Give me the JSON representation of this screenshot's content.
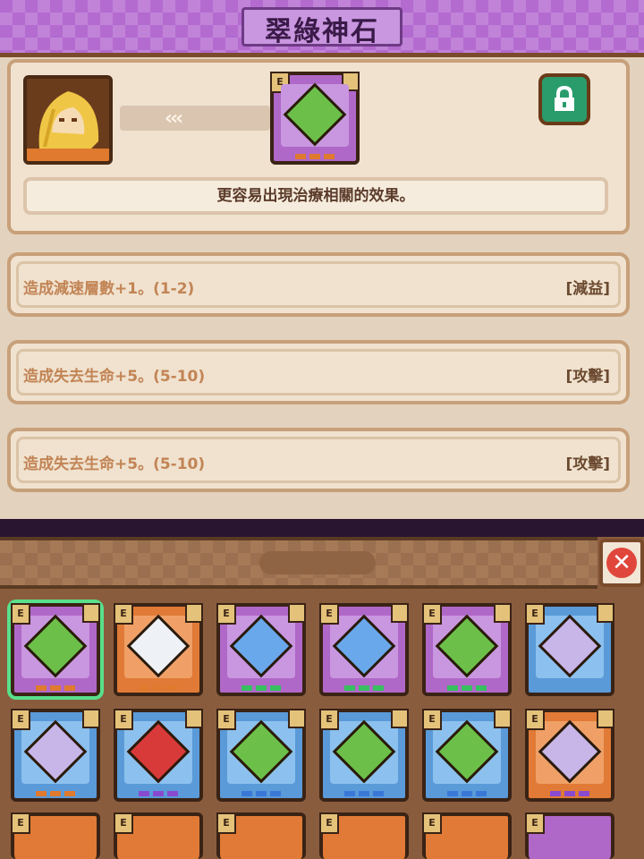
{
  "header": {
    "title": "翠綠神石"
  },
  "item": {
    "description": "更容易出現治療相關的效果。",
    "arrows": "‹‹‹"
  },
  "affixes": [
    {
      "text": "造成減速層數+1。(1-2)",
      "tag": "[減益]"
    },
    {
      "text": "造成失去生命+5。(5-10)",
      "tag": "[攻擊]"
    },
    {
      "text": "造成失去生命+5。(5-10)",
      "tag": "[攻擊]"
    }
  ],
  "inventory": {
    "badge_letter": "E",
    "close_glyph": "✕",
    "gems": [
      {
        "frame": "purple",
        "gem": "green",
        "dots": "orange",
        "selected": true
      },
      {
        "frame": "orange",
        "gem": "white",
        "dots": "orange"
      },
      {
        "frame": "purple",
        "gem": "blue",
        "dots": "green"
      },
      {
        "frame": "purple",
        "gem": "blue",
        "dots": "green"
      },
      {
        "frame": "purple",
        "gem": "green",
        "dots": "green"
      },
      {
        "frame": "blue",
        "gem": "violet",
        "dots": "none"
      },
      {
        "frame": "blue",
        "gem": "violet",
        "dots": "orange"
      },
      {
        "frame": "blue",
        "gem": "red",
        "dots": "purple"
      },
      {
        "frame": "blue",
        "gem": "green",
        "dots": "blue"
      },
      {
        "frame": "blue",
        "gem": "green",
        "dots": "blue"
      },
      {
        "frame": "blue",
        "gem": "green",
        "dots": "blue"
      },
      {
        "frame": "orange",
        "gem": "violet",
        "dots": "purple"
      }
    ]
  },
  "colors": {
    "accent": "#b46bd0",
    "panel": "#f0e2cf",
    "affix_text": "#c28455",
    "select": "#58e08a",
    "close": "#e0463b"
  }
}
